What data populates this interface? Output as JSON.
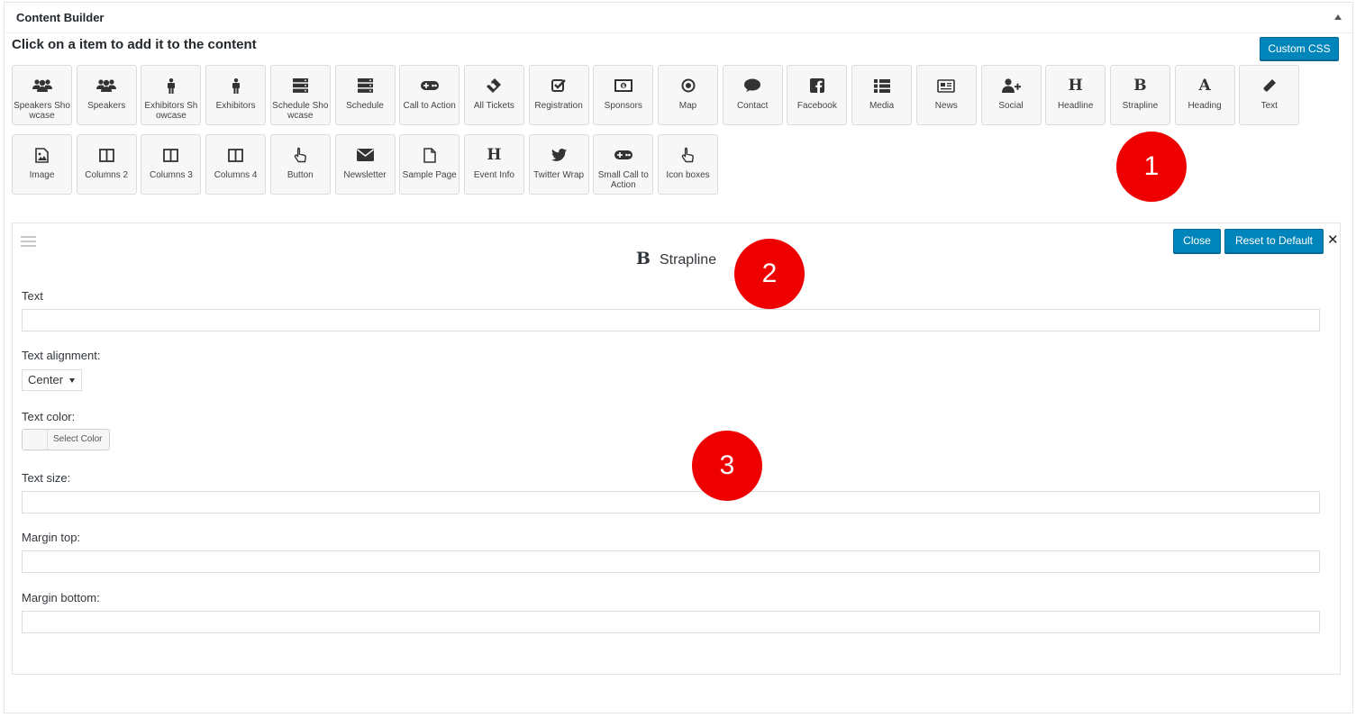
{
  "panel": {
    "title": "Content Builder"
  },
  "instruction": "Click on a item to add it to the content",
  "custom_css_label": "Custom CSS",
  "tiles_row1": [
    {
      "label": "Speakers Showcase",
      "icon": "users-icon"
    },
    {
      "label": "Speakers",
      "icon": "users-icon"
    },
    {
      "label": "Exhibitors Showcase",
      "icon": "person-icon"
    },
    {
      "label": "Exhibitors",
      "icon": "person-icon"
    },
    {
      "label": "Schedule Showcase",
      "icon": "server-icon"
    },
    {
      "label": "Schedule",
      "icon": "server-icon"
    },
    {
      "label": "Call to Action",
      "icon": "gamepad-icon"
    },
    {
      "label": "All Tickets",
      "icon": "ticket-icon"
    },
    {
      "label": "Registration",
      "icon": "checkbox-icon"
    },
    {
      "label": "Sponsors",
      "icon": "money-icon"
    },
    {
      "label": "Map",
      "icon": "dot-circle-icon"
    },
    {
      "label": "Contact",
      "icon": "comment-icon"
    },
    {
      "label": "Facebook",
      "icon": "facebook-icon"
    },
    {
      "label": "Media",
      "icon": "list-icon"
    },
    {
      "label": "News",
      "icon": "newspaper-icon"
    },
    {
      "label": "Social",
      "icon": "user-plus-icon"
    },
    {
      "label": "Headline",
      "icon": "headline-h-icon",
      "glyph": "H"
    },
    {
      "label": "Strapline",
      "icon": "bold-b-icon",
      "glyph": "B"
    },
    {
      "label": "Heading",
      "icon": "letter-a-icon",
      "glyph": "A"
    },
    {
      "label": "Text",
      "icon": "pencil-icon"
    }
  ],
  "tiles_row2": [
    {
      "label": "Image",
      "icon": "image-icon"
    },
    {
      "label": "Columns 2",
      "icon": "columns-icon"
    },
    {
      "label": "Columns 3",
      "icon": "columns-icon"
    },
    {
      "label": "Columns 4",
      "icon": "columns-icon"
    },
    {
      "label": "Button",
      "icon": "pointer-hand-icon"
    },
    {
      "label": "Newsletter",
      "icon": "envelope-icon"
    },
    {
      "label": "Sample Page",
      "icon": "file-icon"
    },
    {
      "label": "Event Info",
      "icon": "headline-h-icon",
      "glyph": "H"
    },
    {
      "label": "Twitter Wrap",
      "icon": "twitter-icon"
    },
    {
      "label": "Small Call to Action",
      "icon": "gamepad-icon"
    },
    {
      "label": "Icon boxes",
      "icon": "pointer-hand-icon"
    }
  ],
  "editor": {
    "title_glyph": "B",
    "title": "Strapline",
    "close_label": "Close",
    "reset_label": "Reset to Default",
    "fields": {
      "text_label": "Text",
      "text_value": "",
      "alignment_label": "Text alignment:",
      "alignment_value": "Center",
      "color_label": "Text color:",
      "color_button": "Select Color",
      "size_label": "Text size:",
      "margin_top_label": "Margin top:",
      "margin_bottom_label": "Margin bottom:"
    }
  },
  "markers": [
    "1",
    "2",
    "3"
  ],
  "colors": {
    "primary_button": "#0085ba",
    "marker": "#ef0000",
    "tile_bg": "#f7f7f7"
  }
}
